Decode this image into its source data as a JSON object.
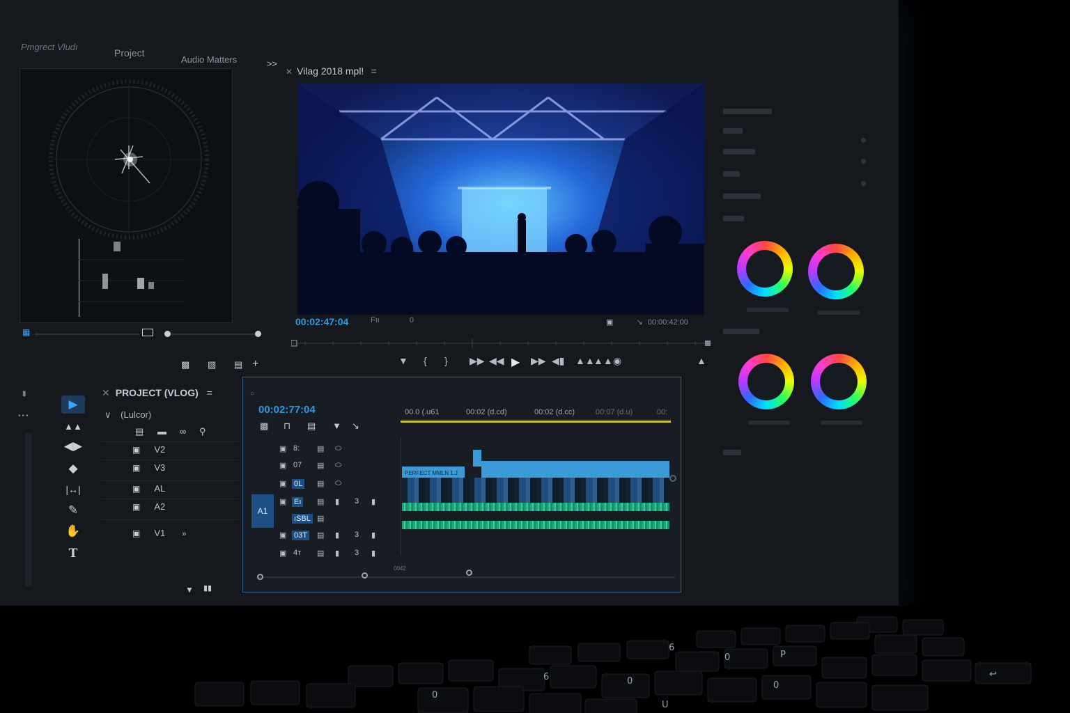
{
  "tabs": {
    "app_name": "Pmgrect Vludı",
    "project": "Project",
    "audio": "Audio Matters",
    "more": ">>"
  },
  "monitor": {
    "close": "✕",
    "title": "Vilag 2018 mpl!",
    "menu": "=",
    "timecode": "00:02:47:04",
    "info_left": "Fıı",
    "info_zero": "0",
    "info_right": "00:00:42:00"
  },
  "project": {
    "close": "✕",
    "title": "PROJECT (VLOG)",
    "menu": "=",
    "folder_chevron": "∨",
    "folder": "(Lulcor)",
    "tracks": [
      "V2",
      "V3",
      "AL",
      "A2",
      "V1"
    ],
    "track_v1_extra": "»"
  },
  "timeline": {
    "timecode": "00:02:77:04",
    "ruler": [
      "00.0 (.u61",
      "00:02 (d.cd)",
      "00:02 (d.cc)",
      "00:07 (d.u)",
      "00:"
    ],
    "clip_title": "PERFECT MMLN 1.J",
    "a1_tag": "A1",
    "track_labels": [
      "8:",
      "07",
      "0L",
      "Eı",
      "ıSBL",
      "03T",
      "4ᴛ"
    ],
    "track_counts": [
      "3",
      "3",
      "3"
    ],
    "footer": "0042"
  },
  "colors": {
    "accent": "#2a9be0",
    "track_blue": "#1d4f85",
    "clip_blue": "#3b9bd6",
    "audio_green": "#1fa77c",
    "work_area": "#c9c625"
  },
  "icons": {
    "tools": [
      "selection-tool-icon",
      "track-select-icon",
      "ripple-edit-icon",
      "razor-icon",
      "slip-icon",
      "pen-icon",
      "hand-icon",
      "type-icon"
    ],
    "transport": [
      "marker-icon",
      "mark-in-icon",
      "mark-out-icon",
      "go-to-in-icon",
      "step-back-icon",
      "play-icon",
      "step-forward-icon",
      "go-to-out-icon",
      "lift-icon",
      "extract-icon",
      "camera-icon"
    ]
  }
}
